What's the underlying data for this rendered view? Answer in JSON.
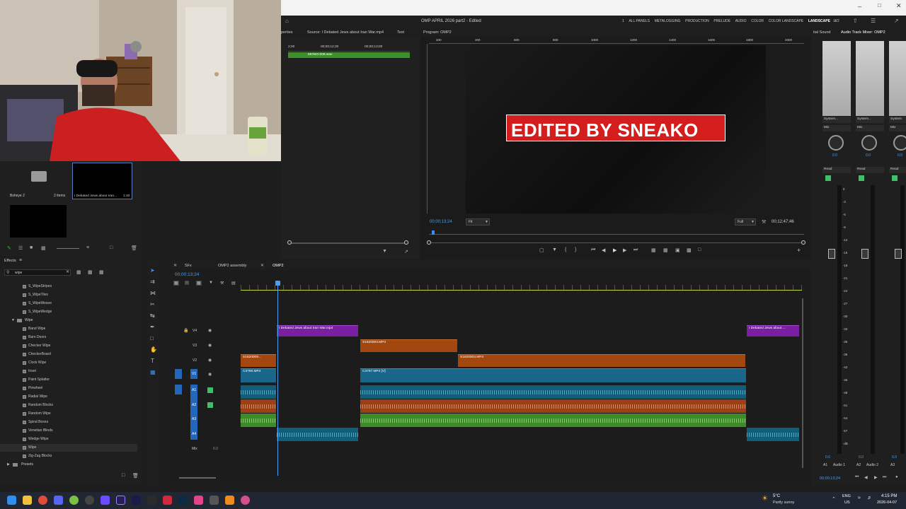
{
  "window": {
    "title": "OMP APRIL 2026 part2 - Edited",
    "workspaces": [
      "ALL PANELS",
      "METALOGGING",
      "PRODUCTION",
      "PRELUDE",
      "AUDIO",
      "COLOR",
      "COLOR LANDSCAPE",
      "LANDSCAPE",
      "V2"
    ],
    "active_workspace": "LANDSCAPE",
    "workspace_prefix": "1"
  },
  "source_panel": {
    "tabs": [
      "perties",
      "Source: I Debated Jews about Iran War.mp4",
      "Text"
    ],
    "ruler": [
      "2;00",
      "00;00;12;30",
      "00;00;13;00"
    ],
    "audio_clip_label": "MONO-008.wav",
    "timecode": "00;00;13;24"
  },
  "project_panel": {
    "bin_label": "Bsheye 2",
    "bin_count": "2 items",
    "clip_label": "I Debated Jews about Iran...",
    "clip_duration": "1:40"
  },
  "program_monitor": {
    "tab": "Program: OMP2",
    "ruler": [
      "200",
      "400",
      "600",
      "800",
      "1000",
      "1200",
      "1400",
      "1600",
      "1800",
      "2000"
    ],
    "overlay_text": "EDITED BY SNEAKO",
    "timecode": "00;00;13;24",
    "fit": "Fit",
    "quality": "Full",
    "duration": "00;12;47;46"
  },
  "effects_panel": {
    "title": "Effects",
    "search_value": "wipe",
    "items": [
      "S_WipeStripes",
      "S_WipeTiles",
      "S_WipeWeave",
      "S_WipeWedge"
    ],
    "folder": "Wipe",
    "wipes": [
      "Band Wipe",
      "Barn Doors",
      "Checker Wipe",
      "CheckerBoard",
      "Clock Wipe",
      "Inset",
      "Paint Splatter",
      "Pinwheel",
      "Radial Wipe",
      "Random Blocks",
      "Random Wipe",
      "Spiral Boxes",
      "Venetian Blinds",
      "Wedge Wipe",
      "Wipe",
      "Zig-Zag Blocks"
    ],
    "presets": "Presets"
  },
  "timeline": {
    "tabs": [
      "SFx",
      "OMP2 assembly",
      "OMP2"
    ],
    "active_tab": "OMP2",
    "timecode": "00;00;13;24",
    "video_tracks": [
      "V4",
      "V3",
      "V2",
      "V1"
    ],
    "audio_tracks": [
      "A1",
      "A2",
      "A3",
      "A4"
    ],
    "mix_label": "Mix",
    "mix_value": "0.0",
    "clips": {
      "v4a": "I Debated Jews about Iran War.mp4",
      "v4b": "I Debated Jews about ...",
      "v3": "S1620003.MP4",
      "v2a": "S1620009...",
      "v2b": "S1620003.MP4",
      "v1a": "C3796.MP4",
      "v1b": "C3797.MP4 [V]"
    }
  },
  "mixer": {
    "tabs": [
      "tial Sound",
      "Audio Track Mixer: OMP2"
    ],
    "channels": [
      {
        "input": "System...",
        "mode": "Mix",
        "value": "0.0",
        "auto": "Read",
        "name": "Audio 1",
        "id": "A1"
      },
      {
        "input": "System...",
        "mode": "Mix",
        "value": "0.0",
        "auto": "Read",
        "name": "Audio 2",
        "id": "A2"
      },
      {
        "input": "System",
        "mode": "Mix",
        "value": "0.0",
        "auto": "Read",
        "name": "",
        "id": "A3"
      }
    ],
    "timecode": "00;00;13;24",
    "scale": [
      "0",
      "-3",
      "-6",
      "-9",
      "-12",
      "-15",
      "-18",
      "-21",
      "-24",
      "-27",
      "-30",
      "-33",
      "-36",
      "-39",
      "-42",
      "-45",
      "-48",
      "-51",
      "-54",
      "-57",
      "-dB"
    ]
  },
  "taskbar": {
    "weather_temp": "5°C",
    "weather_desc": "Partly sunny",
    "lang": "ENG",
    "region": "US",
    "time": "4:15 PM",
    "date": "2026-04-07"
  }
}
